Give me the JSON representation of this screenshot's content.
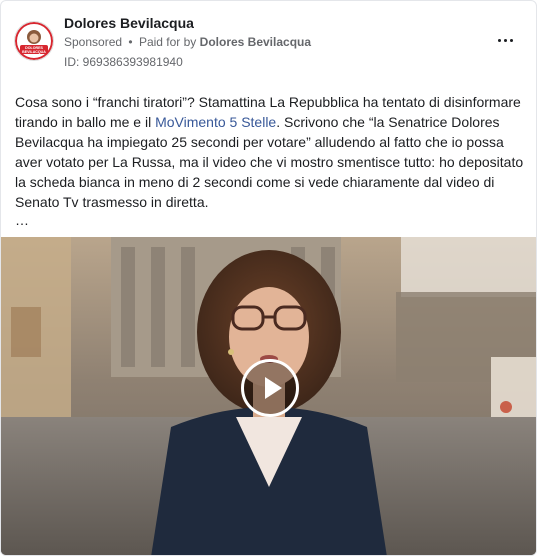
{
  "post": {
    "page_name": "Dolores Bevilacqua",
    "sponsored_label": "Sponsored",
    "separator": "•",
    "paid_for_prefix": "Paid for by",
    "paid_for_by": "Dolores Bevilacqua",
    "ad_id": "ID: 969386393981940",
    "text_before_link": "Cosa sono i “franchi tiratori”? Stamattina La Repubblica ha tentato di disinformare tirando in ballo me e il ",
    "link_text": "MoVimento 5 Stelle",
    "text_after_link": ". Scrivono che “la Senatrice Dolores Bevilacqua ha impiegato 25 secondi per votare” alludendo al fatto che io possa aver votato per La Russa, ma il video che vi mostro smentisce tutto: ho depositato la scheda bianca in meno di 2 secondi come si vede chiaramente dal video di Senato Tv trasmesso in diretta.",
    "see_more": "…"
  },
  "avatar": {
    "logo_text_top": "DOLORES",
    "logo_text_bottom": "BEVILACQUA"
  },
  "icons": {
    "more": "more-horizontal-icon",
    "play": "play-icon"
  },
  "colors": {
    "link": "#385898",
    "text": "#1c1e21",
    "secondary": "#65676b",
    "logo_red": "#d7262f"
  }
}
